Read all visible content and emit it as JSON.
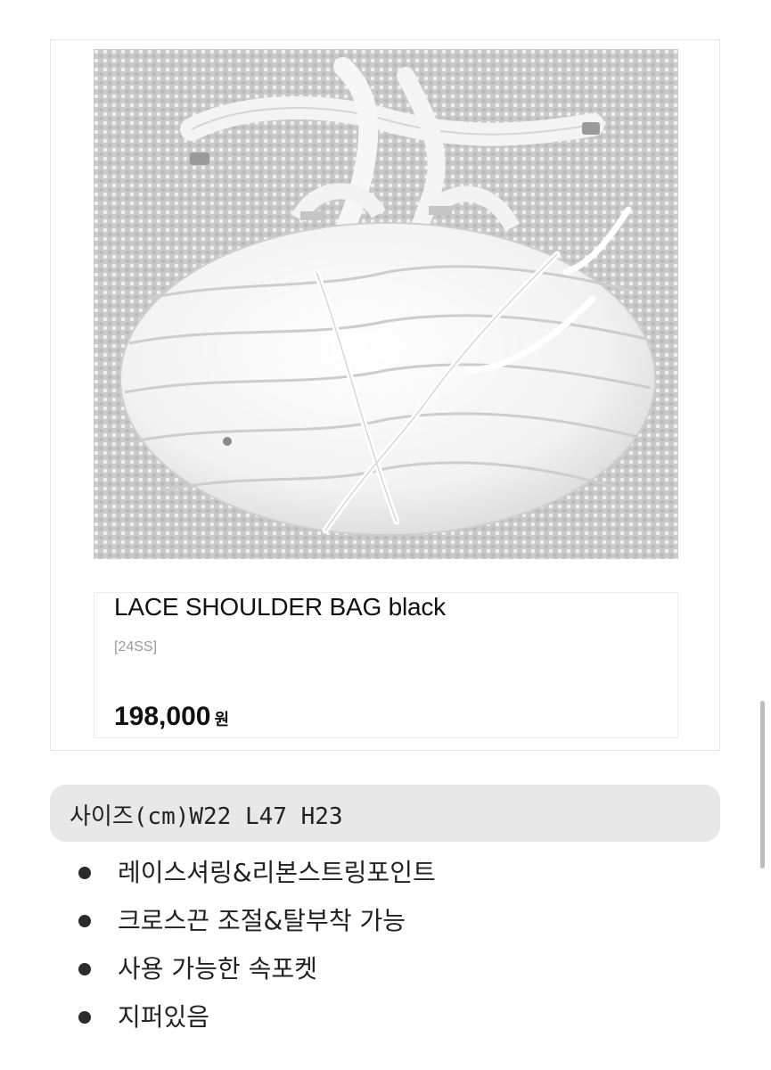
{
  "product": {
    "image_alt": "white ruched lace shoulder bag photo",
    "title": "LACE SHOULDER BAG black",
    "season_tag": "[24SS]",
    "price": "198,000",
    "currency": "원"
  },
  "size_info": "사이즈(cm)W22  L47  H23",
  "features": [
    "레이스셔링&리본스트링포인트",
    "크로스끈 조절&탈부착 가능",
    "사용 가능한 속포켓",
    "지퍼있음"
  ],
  "colors": {
    "background": "#ffffff",
    "size_box": "#e8e8e8",
    "text": "#111111",
    "muted": "#9a9a9a"
  }
}
